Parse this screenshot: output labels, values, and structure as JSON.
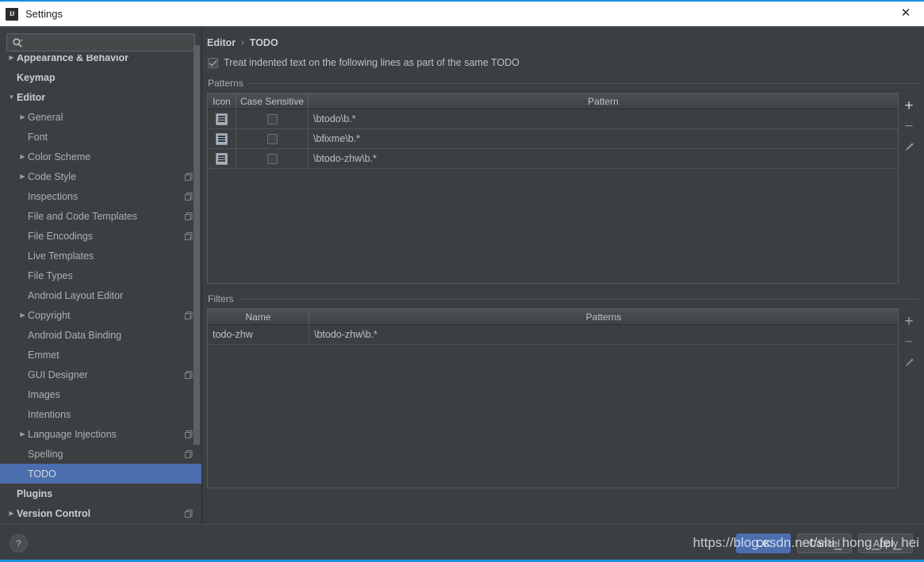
{
  "window": {
    "title": "Settings",
    "app_icon": "IJ",
    "close_icon": "✕"
  },
  "search": {
    "value": "",
    "placeholder": "",
    "icon": "search-icon",
    "dropdown_icon": "▾"
  },
  "sidebar": {
    "items": [
      {
        "label": "Appearance & Behavior",
        "arrow": "▶",
        "bold": true,
        "indent": 0,
        "has_copy": false,
        "selected": false,
        "clipped": true
      },
      {
        "label": "Keymap",
        "arrow": "",
        "bold": true,
        "indent": 0,
        "has_copy": false,
        "selected": false
      },
      {
        "label": "Editor",
        "arrow": "▼",
        "bold": true,
        "indent": 0,
        "has_copy": false,
        "selected": false
      },
      {
        "label": "General",
        "arrow": "▶",
        "bold": false,
        "indent": 1,
        "has_copy": false,
        "selected": false
      },
      {
        "label": "Font",
        "arrow": "",
        "bold": false,
        "indent": 1,
        "has_copy": false,
        "selected": false
      },
      {
        "label": "Color Scheme",
        "arrow": "▶",
        "bold": false,
        "indent": 1,
        "has_copy": false,
        "selected": false
      },
      {
        "label": "Code Style",
        "arrow": "▶",
        "bold": false,
        "indent": 1,
        "has_copy": true,
        "selected": false
      },
      {
        "label": "Inspections",
        "arrow": "",
        "bold": false,
        "indent": 1,
        "has_copy": true,
        "selected": false
      },
      {
        "label": "File and Code Templates",
        "arrow": "",
        "bold": false,
        "indent": 1,
        "has_copy": true,
        "selected": false
      },
      {
        "label": "File Encodings",
        "arrow": "",
        "bold": false,
        "indent": 1,
        "has_copy": true,
        "selected": false
      },
      {
        "label": "Live Templates",
        "arrow": "",
        "bold": false,
        "indent": 1,
        "has_copy": false,
        "selected": false
      },
      {
        "label": "File Types",
        "arrow": "",
        "bold": false,
        "indent": 1,
        "has_copy": false,
        "selected": false
      },
      {
        "label": "Android Layout Editor",
        "arrow": "",
        "bold": false,
        "indent": 1,
        "has_copy": false,
        "selected": false
      },
      {
        "label": "Copyright",
        "arrow": "▶",
        "bold": false,
        "indent": 1,
        "has_copy": true,
        "selected": false
      },
      {
        "label": "Android Data Binding",
        "arrow": "",
        "bold": false,
        "indent": 1,
        "has_copy": false,
        "selected": false
      },
      {
        "label": "Emmet",
        "arrow": "",
        "bold": false,
        "indent": 1,
        "has_copy": false,
        "selected": false
      },
      {
        "label": "GUI Designer",
        "arrow": "",
        "bold": false,
        "indent": 1,
        "has_copy": true,
        "selected": false
      },
      {
        "label": "Images",
        "arrow": "",
        "bold": false,
        "indent": 1,
        "has_copy": false,
        "selected": false
      },
      {
        "label": "Intentions",
        "arrow": "",
        "bold": false,
        "indent": 1,
        "has_copy": false,
        "selected": false
      },
      {
        "label": "Language Injections",
        "arrow": "▶",
        "bold": false,
        "indent": 1,
        "has_copy": true,
        "selected": false
      },
      {
        "label": "Spelling",
        "arrow": "",
        "bold": false,
        "indent": 1,
        "has_copy": true,
        "selected": false
      },
      {
        "label": "TODO",
        "arrow": "",
        "bold": false,
        "indent": 1,
        "has_copy": false,
        "selected": true
      },
      {
        "label": "Plugins",
        "arrow": "",
        "bold": true,
        "indent": 0,
        "has_copy": false,
        "selected": false
      },
      {
        "label": "Version Control",
        "arrow": "▶",
        "bold": true,
        "indent": 0,
        "has_copy": true,
        "selected": false
      }
    ]
  },
  "breadcrumb": {
    "root": "Editor",
    "separator": "›",
    "leaf": "TODO"
  },
  "option": {
    "checked": true,
    "label": "Treat indented text on the following lines as part of the same TODO"
  },
  "patterns": {
    "group_label": "Patterns",
    "columns": [
      "Icon",
      "Case Sensitive",
      "Pattern"
    ],
    "rows": [
      {
        "icon": "note-icon",
        "case_sensitive": false,
        "pattern": "\\btodo\\b.*"
      },
      {
        "icon": "note-icon",
        "case_sensitive": false,
        "pattern": "\\bfixme\\b.*"
      },
      {
        "icon": "note-icon",
        "case_sensitive": false,
        "pattern": "\\btodo-zhw\\b.*"
      }
    ],
    "tools": [
      {
        "name": "add",
        "glyph": "+"
      },
      {
        "name": "remove",
        "glyph": "−"
      },
      {
        "name": "edit",
        "glyph": "pencil"
      }
    ]
  },
  "filters": {
    "group_label": "Filters",
    "columns": [
      "Name",
      "Patterns"
    ],
    "rows": [
      {
        "name": "todo-zhw",
        "patterns": "\\btodo-zhw\\b.*"
      }
    ],
    "tools": [
      {
        "name": "add",
        "glyph": "+"
      },
      {
        "name": "remove",
        "glyph": "−"
      },
      {
        "name": "edit",
        "glyph": "pencil"
      }
    ]
  },
  "footer": {
    "help_label": "?",
    "ok_label": "OK",
    "cancel_label": "Cancel",
    "apply_label": "Apply"
  },
  "watermark": {
    "text": "https://blog.csdn.net/shi_hong_fei_hei"
  },
  "colors": {
    "background": "#3c3f41",
    "selection": "#4b6eaf",
    "accent": "#1a8fe0",
    "text": "#bcc1c5",
    "title_bar": "#ffffff"
  }
}
